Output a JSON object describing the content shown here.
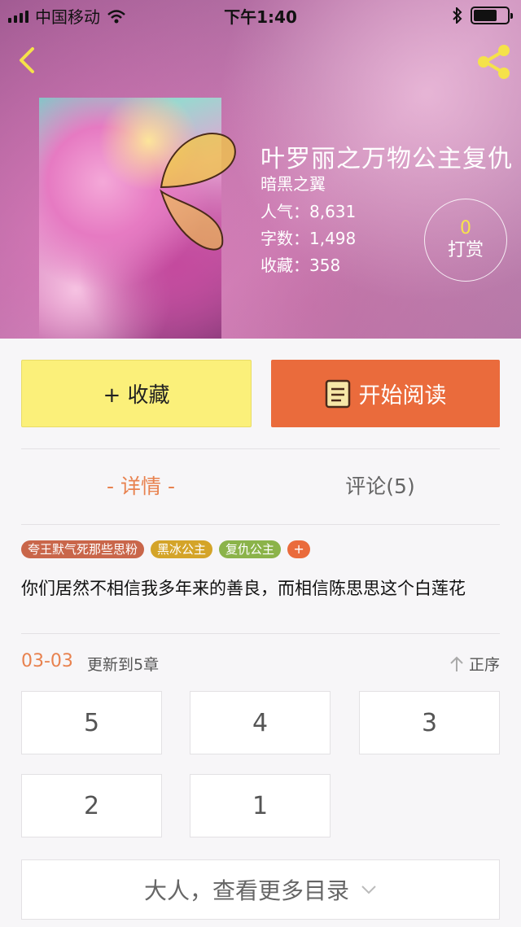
{
  "status_bar": {
    "carrier": "中国移动",
    "time": "下午1:40"
  },
  "book": {
    "title": "叶罗丽之万物公主复仇",
    "author": "暗黑之翼",
    "popularity_label": "人气：",
    "popularity": "8,631",
    "words_label": "字数：",
    "words": "1,498",
    "favorites_label": "收藏：",
    "favorites": "358"
  },
  "tip": {
    "count": "0",
    "label": "打赏"
  },
  "actions": {
    "favorite": "+ 收藏",
    "read": "开始阅读"
  },
  "tabs": {
    "detail": "- 详情 -",
    "comments": "评论(5)"
  },
  "tags": [
    {
      "label": "夸王默气死那些思粉",
      "color": "#c9664a"
    },
    {
      "label": "黑冰公主",
      "color": "#d4a429"
    },
    {
      "label": "复仇公主",
      "color": "#8bb34a"
    }
  ],
  "tag_add": "+",
  "description": "你们居然不相信我多年来的善良，而相信陈思思这个白莲花",
  "update": {
    "date": "03-03",
    "text": "更新到5章",
    "sort": "正序"
  },
  "chapters": [
    "5",
    "4",
    "3",
    "2",
    "1"
  ],
  "more_catalog": "大人，查看更多目录",
  "colors": {
    "accent": "#ea6b3c",
    "favorite_bg": "#fbf07a",
    "tab_active": "#e8824f"
  },
  "icons": [
    "back-icon",
    "share-icon",
    "wifi-icon",
    "bluetooth-icon",
    "battery-icon",
    "book-icon",
    "sort-up-icon",
    "chevron-down-icon"
  ]
}
